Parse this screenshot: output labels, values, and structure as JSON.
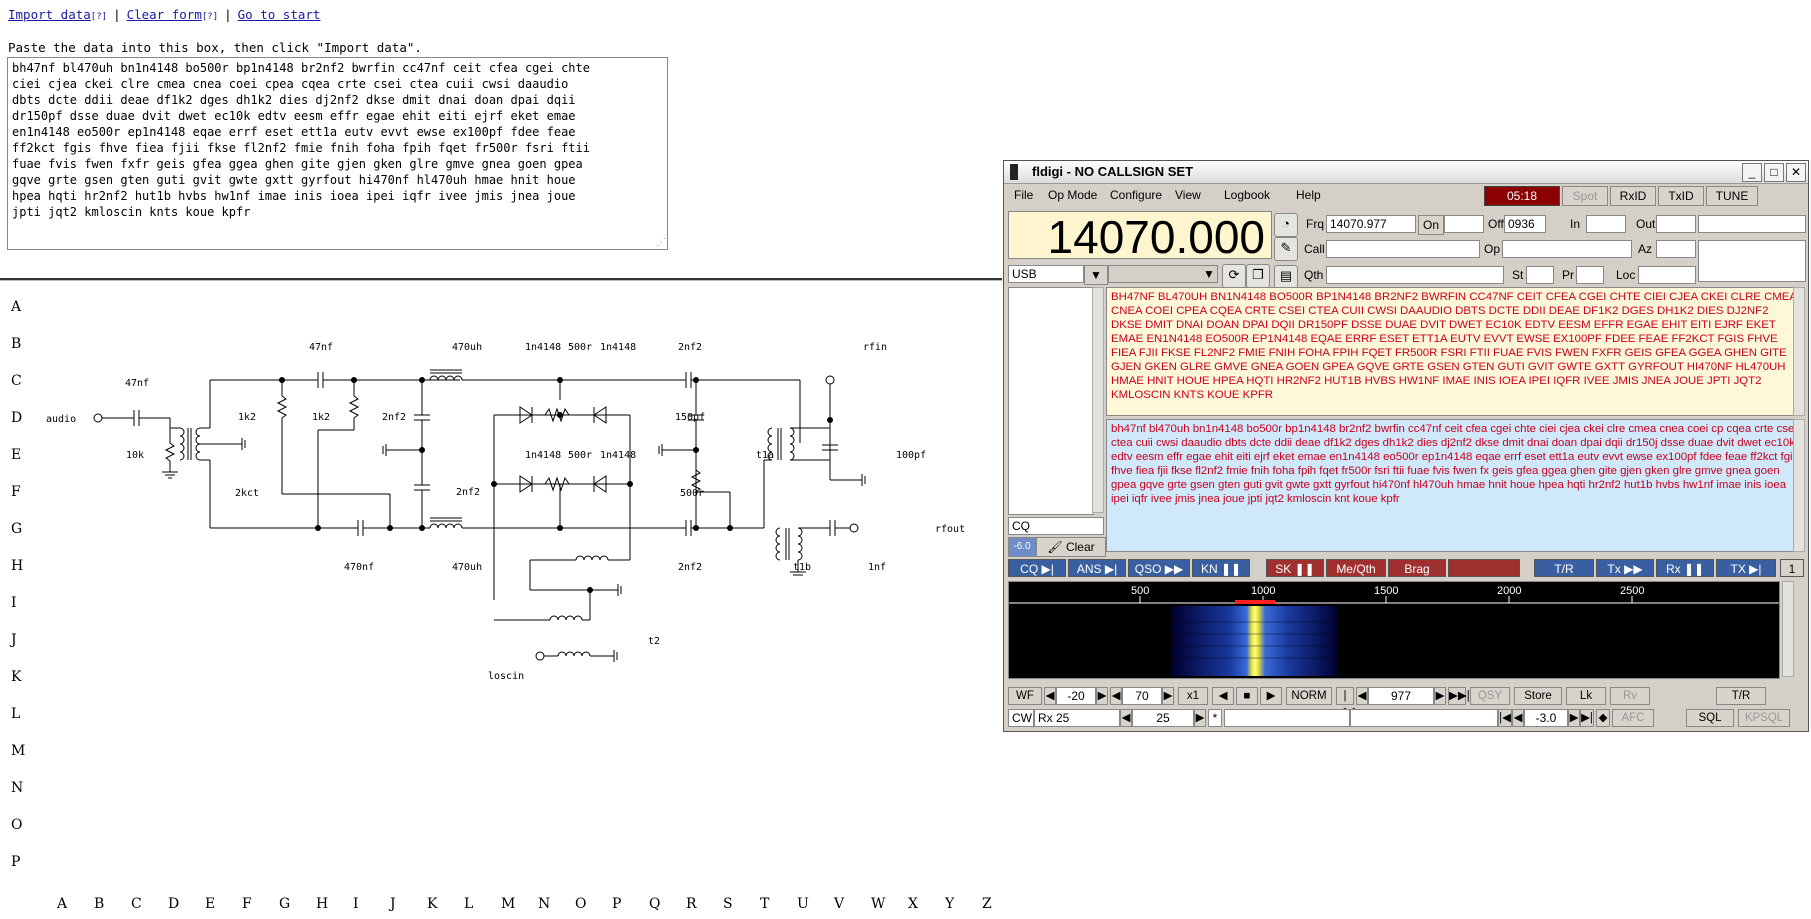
{
  "links": {
    "import": "Import data",
    "import_help": "[?]",
    "clear": "Clear form",
    "clear_help": "[?]",
    "start": "Go to start",
    "sep": "|"
  },
  "instructions": "Paste the data into this box, then click \"Import data\".",
  "data_text": "bh47nf bl470uh bn1n4148 bo500r bp1n4148 br2nf2 bwrfin cc47nf ceit cfea cgei chte\nciei cjea ckei clre cmea cnea coei cpea cqea crte csei ctea cuii cwsi daaudio\ndbts dcte ddii deae df1k2 dges dh1k2 dies dj2nf2 dkse dmit dnai doan dpai dqii\ndr150pf dsse duae dvit dwet ec10k edtv eesm effr egae ehit eiti ejrf eket emae\nen1n4148 eo500r ep1n4148 eqae errf eset ett1a eutv evvt ewse ex100pf fdee feae\nff2kct fgis fhve fiea fjii fkse fl2nf2 fmie fnih foha fpih fqet fr500r fsri ftii\nfuae fvis fwen fxfr geis gfea ggea ghen gite gjen gken glre gmve gnea goen gpea\ngqve grte gsen gten guti gvit gwte gxtt gyrfout hi470nf hl470uh hmae hnit houe\nhpea hqti hr2nf2 hut1b hvbs hw1nf imae inis ioea ipei iqfr ivee jmis jnea joue\njpti jqt2 kmloscin knts koue kpfr",
  "grid": {
    "rows": [
      "A",
      "B",
      "C",
      "D",
      "E",
      "F",
      "G",
      "H",
      "I",
      "J",
      "K",
      "L",
      "M",
      "N",
      "O",
      "P"
    ],
    "cols": [
      "A",
      "B",
      "C",
      "D",
      "E",
      "F",
      "G",
      "H",
      "I",
      "J",
      "K",
      "L",
      "M",
      "N",
      "O",
      "P",
      "Q",
      "R",
      "S",
      "T",
      "U",
      "V",
      "W",
      "X",
      "Y",
      "Z"
    ]
  },
  "schematic_labels": {
    "audio": "audio",
    "c47nf_left": "47nf",
    "r10k": "10k",
    "r1k2a": "1k2",
    "r1k2b": "1k2",
    "t2kct": "2kct",
    "c47nf_top": "47nf",
    "l470uh_top": "470uh",
    "d1n4148a": "1n4148",
    "r500a": "500r",
    "d1n4148b": "1n4148",
    "c2nf2_top": "2nf2",
    "rfin": "rfin",
    "c2nf2_mid": "2nf2",
    "c2nf2_e": "2nf2",
    "d1n4148c": "1n4148",
    "r500b": "500r",
    "d1n4148d": "1n4148",
    "c150pf": "150pf",
    "r500c": "500r",
    "t1a": "t1a",
    "c100pf": "100pf",
    "rfout": "rfout",
    "c470nf": "470nf",
    "l470uh_bot": "470uh",
    "c2nf2_bot": "2nf2",
    "t1b": "t1b",
    "c1nf": "1nf",
    "t2": "t2",
    "loscin": "loscin"
  },
  "fldigi": {
    "title": "fldigi - NO CALLSIGN SET",
    "menus": [
      "File",
      "Op Mode",
      "Configure",
      "View",
      "Logbook",
      "Help"
    ],
    "clock": "05:18",
    "spot": "Spot",
    "rxid": "RxID",
    "txid": "TxID",
    "tune": "TUNE",
    "freq": "14070.000",
    "frq_label": "Frq",
    "frq_value": "14070.977",
    "on_label": "On",
    "off_label": "Off",
    "off_value": "0936",
    "in_label": "In",
    "out_label": "Out",
    "call_label": "Call",
    "op_label": "Op",
    "az_label": "Az",
    "qth_label": "Qth",
    "st_label": "St",
    "pr_label": "Pr",
    "loc_label": "Loc",
    "mode_select": "USB",
    "rx_text": "BH47NF BL470UH BN1N4148 BO500R BP1N4148 BR2NF2 BWRFIN CC47NF CEIT CFEA CGEI CHTE CIEI CJEA CKEI CLRE CMEA CNEA COEI CPEA CQEA CRTE CSEI CTEA CUII CWSI DAAUDIO DBTS DCTE DDII DEAE DF1K2 DGES DH1K2 DIES DJ2NF2 DKSE DMIT DNAI DOAN DPAI DQII DR150PF DSSE DUAE DVIT DWET EC10K EDTV EESM EFFR EGAE EHIT EITI EJRF EKET EMAE EN1N4148 EO500R EP1N4148 EQAE ERRF ESET ETT1A EUTV EVVT EWSE EX100PF FDEE FEAE FF2KCT FGIS FHVE FIEA FJII FKSE FL2NF2 FMIE FNIH FOHA FPIH FQET FR500R FSRI FTII FUAE FVIS FWEN FXFR GEIS GFEA GGEA GHEN GITE GJEN GKEN GLRE GMVE GNEA GOEN GPEA GQVE GRTE GSEN GTEN GUTI GVIT GWTE GXTT GYRFOUT HI470NF HL470UH HMAE HNIT HOUE HPEA HQTI HR2NF2 HUT1B HVBS HW1NF IMAE INIS IOEA IPEI IQFR IVEE JMIS JNEA JOUE JPTI JQT2 KMLOSCIN KNTS KOUE KPFR",
    "tx_text": "bh47nf bl470uh bn1n4148 bo500r bp1n4148 br2nf2 bwrfin cc47nf ceit cfea cgei chte ciei cjea ckei clre cmea cnea coei cp cqea crte csei ctea cuii cwsi daaudio dbts dcte ddii deae df1k2 dges dh1k2 dies dj2nf2 dkse dmit dnai doan dpai dqii dr150j dsse duae dvit dwet ec10k edtv eesm effr egae ehit eiti ejrf eket emae en1n4148 eo500r ep1n4148 eqae errf eset ett1a eutv evvt ewse ex100pf fdee feae ff2kct fgis fhve fiea fjii fkse fl2nf2 fmie fnih foha fpih fqet fr500r fsri ftii fuae fvis fwen fx geis gfea ggea ghen gite gjen gken glre gmve gnea goen gpea gqve grte gsen gten guti gvit gwte gxtt gyrfout hi470nf hl470uh hmae hnit houe hpea hqti hr2nf2 hut1b hvbs hw1nf imae inis ioea ipei iqfr ivee jmis jnea joue jpti jqt2 kmloscin knt koue kpfr",
    "cq_field": "CQ",
    "level": "-6.0",
    "clear": "Clear",
    "macros": [
      "CQ",
      "ANS",
      "QSO",
      "KN",
      "SK",
      "Me/Qth",
      "Brag",
      "",
      "T/R",
      "Tx",
      "Rx",
      "TX"
    ],
    "macro_page": "1",
    "scale": [
      "500",
      "1000",
      "1500",
      "2000",
      "2500"
    ],
    "wf_btn": "WF",
    "wf_low": "-20",
    "wf_range": "70",
    "wf_x1": "x1",
    "wf_norm": "NORM",
    "wf_freq": "977",
    "qsy": "QSY",
    "store": "Store",
    "lk": "Lk",
    "rv": "Rv",
    "tr": "T/R",
    "mode": "CW",
    "rx_label": "Rx 25",
    "rx_value": "25",
    "star": "*",
    "afc_value": "-3.0",
    "afc": "AFC",
    "sql": "SQL",
    "kpsql": "KPSQL"
  }
}
